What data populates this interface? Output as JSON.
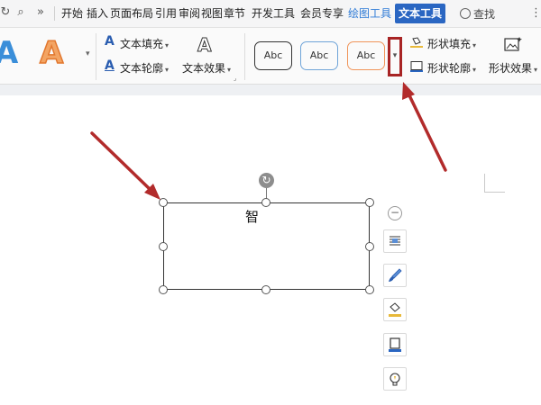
{
  "menubar": {
    "tabs": [
      "开始",
      "插入",
      "页面布局",
      "引用",
      "审阅",
      "视图",
      "章节",
      "开发工具",
      "会员专享",
      "绘图工具",
      "文本工具"
    ],
    "active_tab": "文本工具",
    "highlight_tab": "绘图工具",
    "search_label": "查找"
  },
  "ribbon": {
    "text_fill": "文本填充",
    "text_outline": "文本轮廓",
    "text_effect": "文本效果",
    "style_preview_1": "Abc",
    "style_preview_2": "Abc",
    "style_preview_3": "Abc",
    "shape_fill": "形状填充",
    "shape_outline": "形状轮廓",
    "shape_effect": "形状效果",
    "art_letter": "A",
    "caret": "▾"
  },
  "document": {
    "textbox_text": "智"
  },
  "colors": {
    "active_tab_bg": "#2a66c2",
    "highlight_tab": "#2f7bd6",
    "annotation_red": "#b22b2b",
    "style_box_blue": "#6fa4d8",
    "style_box_orange": "#f0955a"
  }
}
